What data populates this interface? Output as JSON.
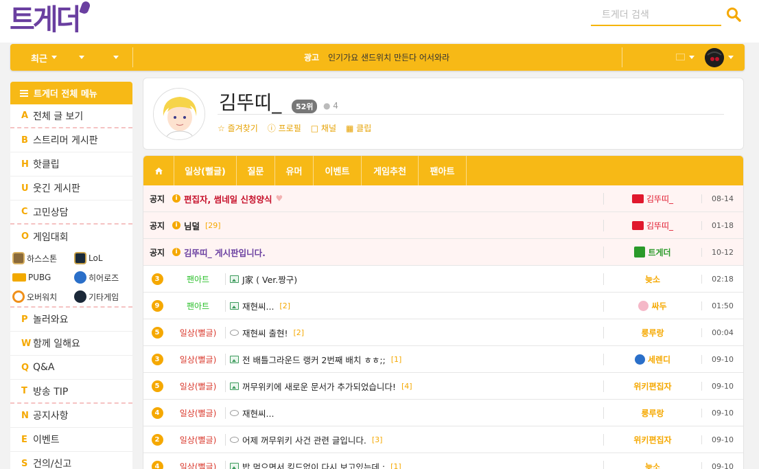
{
  "logo": "트게더",
  "search": {
    "placeholder": "트게더 검색"
  },
  "topbar": {
    "recent": "최근",
    "ad_label": "광고",
    "ad_text": "인기가요 샌드위치 만든다 어서와라"
  },
  "sidebar": {
    "header": "트게더 전체 메뉴",
    "items_top": [
      {
        "letter": "A",
        "label": "전체 글 보기"
      },
      {
        "letter": "B",
        "label": "스트리머 게시판"
      },
      {
        "letter": "H",
        "label": "핫클립"
      },
      {
        "letter": "U",
        "label": "웃긴 게시판"
      },
      {
        "letter": "C",
        "label": "고민상담"
      },
      {
        "letter": "O",
        "label": "게임대회"
      }
    ],
    "games": [
      "하스스톤",
      "LoL",
      "PUBG",
      "히어로즈",
      "오버워치",
      "기타게임"
    ],
    "items_bottom": [
      {
        "letter": "P",
        "label": "놀러와요"
      },
      {
        "letter": "W",
        "label": "함께 일해요"
      },
      {
        "letter": "Q",
        "label": "Q&A"
      },
      {
        "letter": "T",
        "label": "방송 TIP"
      },
      {
        "letter": "N",
        "label": "공지사항"
      },
      {
        "letter": "E",
        "label": "이벤트"
      },
      {
        "letter": "S",
        "label": "건의/신고"
      }
    ]
  },
  "profile": {
    "name": "김뚜띠_",
    "rank": "52위",
    "fans": "4",
    "links": [
      "즐겨찾기",
      "프로필",
      "채널",
      "클립"
    ]
  },
  "tabs": [
    "일상(뻘글)",
    "질문",
    "유머",
    "이벤트",
    "게임추천",
    "팬아트"
  ],
  "notice_label": "공지",
  "posts": [
    {
      "notice": true,
      "title": "편집자, 썸네일 신청양식",
      "heart": true,
      "comments": "",
      "author": "김뚜띠_",
      "author_style": "red",
      "date": "08-14"
    },
    {
      "notice": true,
      "title": "님덜",
      "comments": "[29]",
      "author": "김뚜띠_",
      "author_style": "red",
      "date": "01-18"
    },
    {
      "notice": true,
      "title": "김뚜띠_ 게시판입니다.",
      "comments": "",
      "author": "트게더",
      "author_style": "green",
      "date": "10-12",
      "title_color": "#6a3fa0"
    },
    {
      "notice": false,
      "num": "3",
      "category": "팬아트",
      "cat_style": "green",
      "icon": "image",
      "title": "J家 ( Ver.짱구)",
      "comments": "",
      "author": "늦소",
      "date": "02:18"
    },
    {
      "notice": false,
      "num": "9",
      "category": "팬아트",
      "cat_style": "green",
      "icon": "image",
      "title": "재현씨...",
      "comments": "[2]",
      "author": "싸두",
      "date": "01:50"
    },
    {
      "notice": false,
      "num": "5",
      "category": "일상(뻘글)",
      "cat_style": "red",
      "icon": "bubble",
      "title": "재현씨 출현!",
      "comments": "[2]",
      "author": "룽루랑",
      "date": "00:04"
    },
    {
      "notice": false,
      "num": "3",
      "category": "일상(뻘글)",
      "cat_style": "red",
      "icon": "image",
      "title": "전 배틀그라운드 랭커 2번째 배치 ㅎㅎ;;",
      "comments": "[1]",
      "author": "세렌디",
      "date": "09-10"
    },
    {
      "notice": false,
      "num": "5",
      "category": "일상(뻘글)",
      "cat_style": "red",
      "icon": "image",
      "title": "꺼무위키에 새로운 문서가 추가되었습니다!",
      "comments": "[4]",
      "author": "위키편집자",
      "date": "09-10"
    },
    {
      "notice": false,
      "num": "4",
      "category": "일상(뻘글)",
      "cat_style": "red",
      "icon": "bubble",
      "title": "재현씨...",
      "comments": "",
      "author": "룽루랑",
      "date": "09-10"
    },
    {
      "notice": false,
      "num": "2",
      "category": "일상(뻘글)",
      "cat_style": "red",
      "icon": "bubble",
      "title": "어제 꺼무위키 사건 관련 글입니다.",
      "comments": "[3]",
      "author": "위키편집자",
      "date": "09-10"
    },
    {
      "notice": false,
      "num": "4",
      "category": "일상(뻘글)",
      "cat_style": "red",
      "icon": "image",
      "title": "밥 먹으면서 킹드없이 다시 보고있는데 ;",
      "comments": "[1]",
      "author": "늦소",
      "date": "09-10"
    }
  ]
}
